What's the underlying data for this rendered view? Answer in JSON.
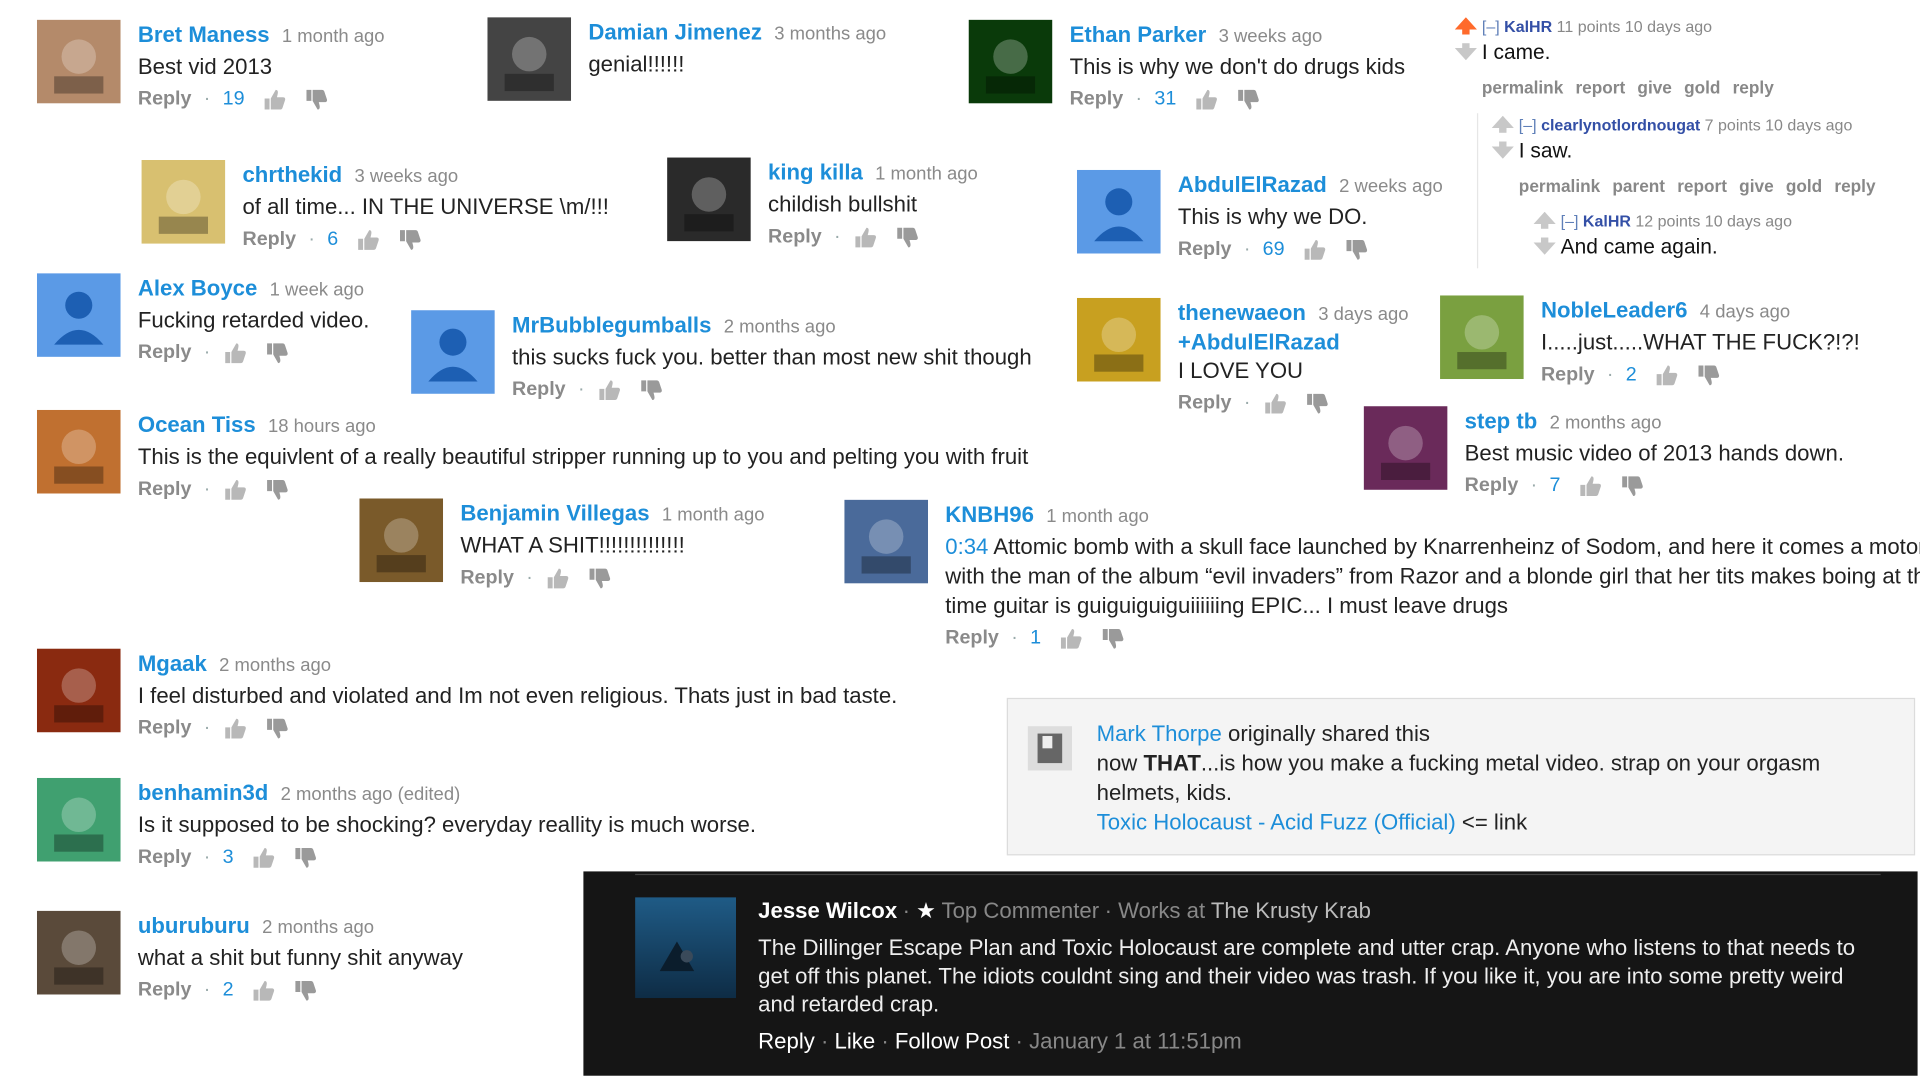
{
  "yt_comments": [
    {
      "name": "Bret Maness",
      "time": "1 month ago",
      "text": "Best vid 2013",
      "reply": "Reply",
      "likes": "19"
    },
    {
      "name": "Damian Jimenez",
      "time": "3 months ago",
      "text": "genial!!!!!!",
      "reply": "",
      "likes": ""
    },
    {
      "name": "Ethan Parker",
      "time": "3 weeks ago",
      "text": "This is why we don't do drugs kids",
      "reply": "Reply",
      "likes": "31"
    },
    {
      "name": "chrthekid",
      "time": "3 weeks ago",
      "text": "of all time... IN THE UNIVERSE \\m/!!!",
      "reply": "Reply",
      "likes": "6"
    },
    {
      "name": "king killa",
      "time": "1 month ago",
      "text": "childish bullshit",
      "reply": "Reply",
      "likes": ""
    },
    {
      "name": "AbdulElRazad",
      "time": "2 weeks ago",
      "text": "This is why we DO.",
      "reply": "Reply",
      "likes": "69"
    },
    {
      "name": "Alex Boyce",
      "time": "1 week ago",
      "text": "Fucking retarded video.",
      "reply": "Reply",
      "likes": ""
    },
    {
      "name": "MrBubblegumballs",
      "time": "2 months ago",
      "text": "this sucks fuck you. better than most new shit though",
      "reply": "Reply",
      "likes": ""
    },
    {
      "name": "thenewaeon",
      "time": "3 days ago",
      "text": "I LOVE YOU",
      "mention": "+AbdulElRazad",
      "reply": "Reply",
      "likes": ""
    },
    {
      "name": "NobleLeader6",
      "time": "4 days ago",
      "text": "I.....just.....WHAT THE FUCK?!?!",
      "reply": "Reply",
      "likes": "2"
    },
    {
      "name": "Ocean Tiss",
      "time": "18 hours ago",
      "text": "This is the equivlent of a really beautiful stripper running up to you and pelting you with fruit",
      "reply": "Reply",
      "likes": ""
    },
    {
      "name": "step tb",
      "time": "2 months ago",
      "text": "Best music video of 2013 hands down.",
      "reply": "Reply",
      "likes": "7"
    },
    {
      "name": "Benjamin Villegas",
      "time": "1 month ago",
      "text": "WHAT A SHIT!!!!!!!!!!!!!!",
      "reply": "Reply",
      "likes": ""
    },
    {
      "name": "KNBH96",
      "time": "1 month ago",
      "timestamp": "0:34",
      "text": " Attomic bomb with a skull face launched by Knarrenheinz of Sodom, and here it comes a motorcycle with the man of the album “evil invaders” from Razor and a blonde girl that her tits makes boing at the same time guitar is guiguiguiguiiiiiing EPIC... I must leave drugs",
      "reply": "Reply",
      "likes": "1"
    },
    {
      "name": "Mgaak",
      "time": "2 months ago",
      "text": "I feel disturbed and violated and Im not even religious. Thats just in bad taste.",
      "reply": "Reply",
      "likes": ""
    },
    {
      "name": "benhamin3d",
      "time": "2 months ago (edited)",
      "text": "Is it supposed to be shocking? everyday reallity is much worse.",
      "reply": "Reply",
      "likes": "3"
    },
    {
      "name": "uburuburu",
      "time": "2 months ago",
      "text": "what a shit but funny shit anyway",
      "reply": "Reply",
      "likes": "2"
    }
  ],
  "reddit": [
    {
      "collapse": "[–]",
      "user": "KalHR",
      "meta": "11 points 10 days ago",
      "text": "I came.",
      "actions": "permalink report give gold reply"
    },
    {
      "collapse": "[–]",
      "user": "clearlynotlordnougat",
      "meta": "7 points 10 days ago",
      "text": "I saw.",
      "actions": "permalink parent report give gold reply"
    },
    {
      "collapse": "[–]",
      "user": "KalHR",
      "meta": "12 points 10 days ago",
      "text": "And came again.",
      "actions": ""
    }
  ],
  "gplus": {
    "name": "Mark Thorpe",
    "shared": " originally shared this",
    "text_pre": "now ",
    "text_bold": "THAT",
    "text_post": "...is how you make a fucking metal video.  strap on your orgasm helmets, kids.",
    "link": "Toxic Holocaust - Acid Fuzz (Official)",
    "link_suffix": "  <= link"
  },
  "facebook": {
    "name": "Jesse Wilcox",
    "badge": "Top Commenter",
    "works_label": "Works at ",
    "works": "The Krusty Krab",
    "text": "The Dillinger Escape Plan and Toxic Holocaust are complete and utter crap. Anyone who listens to that needs to get off this planet. The idiots couldnt sing and their video was trash. If you like it, you are into some pretty weird and retarded crap.",
    "reply": "Reply",
    "like": "Like",
    "follow": "Follow Post",
    "date": "January 1 at 11:51pm"
  },
  "colors": {
    "link": "#1d8ed9",
    "muted": "#8a8a8a",
    "fb_bg": "#151515",
    "reddit_user": "#334fa6"
  }
}
